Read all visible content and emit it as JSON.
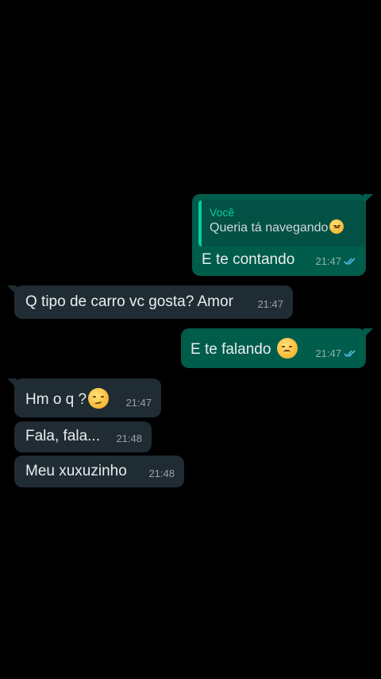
{
  "colors": {
    "background": "#000000",
    "outgoing_bubble": "#005c4b",
    "incoming_bubble": "#202c33",
    "read_ticks": "#53bdeb",
    "quote_accent": "#06cf9c"
  },
  "messages": [
    {
      "direction": "outgoing",
      "quote": {
        "author": "Você",
        "text": "Queria tá navegando",
        "emoji": "pensive-face-icon"
      },
      "text": "E te contando",
      "time": "21:47",
      "status": "read"
    },
    {
      "direction": "incoming",
      "text": "Q tipo de carro vc gosta? Amor",
      "time": "21:47"
    },
    {
      "direction": "outgoing",
      "text": "E te falando",
      "emoji": "pensive-face-icon",
      "time": "21:47",
      "status": "read"
    },
    {
      "direction": "incoming",
      "text": "Hm o q ?",
      "emoji": "smirking-face-icon",
      "time": "21:47"
    },
    {
      "direction": "incoming",
      "text": "Fala, fala...",
      "time": "21:48"
    },
    {
      "direction": "incoming",
      "text": "Meu xuxuzinho",
      "time": "21:48"
    }
  ]
}
